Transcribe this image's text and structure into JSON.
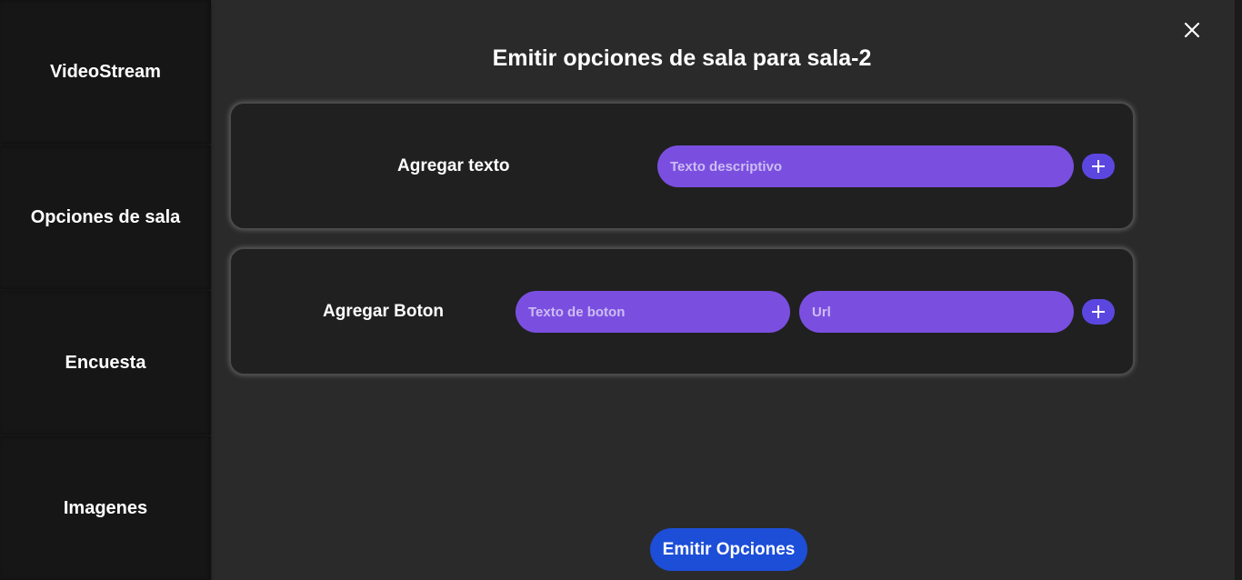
{
  "sidebar": {
    "items": [
      {
        "label": "VideoStream"
      },
      {
        "label": "Opciones de sala"
      },
      {
        "label": "Encuesta"
      },
      {
        "label": "Imagenes"
      }
    ]
  },
  "dialog": {
    "title": "Emitir opciones de sala para sala-2",
    "close_icon": "close-icon"
  },
  "text_card": {
    "label": "Agregar texto",
    "input_placeholder": "Texto descriptivo",
    "input_value": "",
    "add_icon": "plus-icon"
  },
  "button_card": {
    "label": "Agregar Boton",
    "button_text_placeholder": "Texto de boton",
    "url_placeholder": "Url",
    "add_icon": "plus-icon"
  },
  "footer": {
    "emit_label": "Emitir Opciones"
  },
  "colors": {
    "background": "#2a2a2a",
    "sidebar": "#161616",
    "card": "#202020",
    "input": "#7a4fe0",
    "plus_button": "#5b47e0",
    "primary_button": "#1d4ed8"
  }
}
